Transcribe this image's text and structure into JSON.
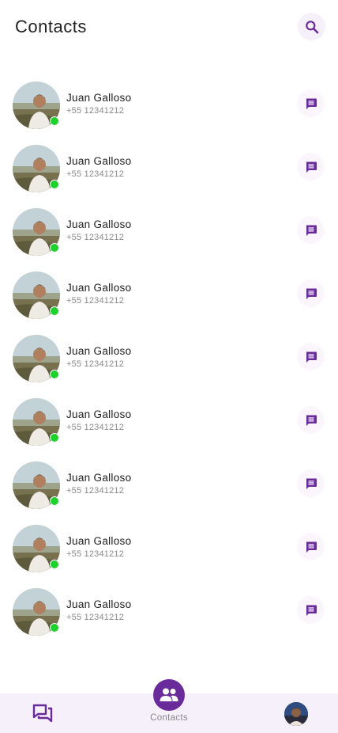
{
  "header": {
    "title": "Contacts",
    "search_icon": "search-icon"
  },
  "colors": {
    "accent": "#6a2b9a",
    "accent_light": "#f6f0fa",
    "online": "#1fd12d"
  },
  "contacts": [
    {
      "name": "Juan Galloso",
      "phone": "+55 12341212",
      "online": true
    },
    {
      "name": "Juan Galloso",
      "phone": "+55 12341212",
      "online": true
    },
    {
      "name": "Juan Galloso",
      "phone": "+55 12341212",
      "online": true
    },
    {
      "name": "Juan Galloso",
      "phone": "+55 12341212",
      "online": true
    },
    {
      "name": "Juan Galloso",
      "phone": "+55 12341212",
      "online": true
    },
    {
      "name": "Juan Galloso",
      "phone": "+55 12341212",
      "online": true
    },
    {
      "name": "Juan Galloso",
      "phone": "+55 12341212",
      "online": true
    },
    {
      "name": "Juan Galloso",
      "phone": "+55 12341212",
      "online": true
    },
    {
      "name": "Juan Galloso",
      "phone": "+55 12341212",
      "online": true
    }
  ],
  "bottom_nav": {
    "chats_icon": "forum-icon",
    "contacts_icon": "people-icon",
    "contacts_label": "Contacts",
    "profile_icon": "profile-avatar"
  }
}
